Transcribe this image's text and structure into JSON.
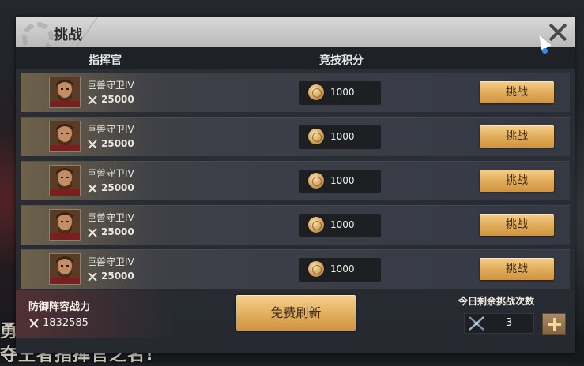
{
  "scene": {
    "text_line1": "勇",
    "text_line2": "夺王者指挥官之名!"
  },
  "dialog": {
    "title": "挑战",
    "columns": {
      "commander": "指挥官",
      "score": "竞技积分"
    },
    "rows": [
      {
        "name": "巨兽守卫IV",
        "power": "25000",
        "score": "1000",
        "button": "挑战"
      },
      {
        "name": "巨兽守卫IV",
        "power": "25000",
        "score": "1000",
        "button": "挑战"
      },
      {
        "name": "巨兽守卫IV",
        "power": "25000",
        "score": "1000",
        "button": "挑战"
      },
      {
        "name": "巨兽守卫IV",
        "power": "25000",
        "score": "1000",
        "button": "挑战"
      },
      {
        "name": "巨兽守卫IV",
        "power": "25000",
        "score": "1000",
        "button": "挑战"
      }
    ],
    "defense": {
      "label": "防御阵容战力",
      "power": "1832585"
    },
    "refresh_button": "免费刷新",
    "remaining": {
      "label": "今日剩余挑战次数",
      "count": "3"
    }
  },
  "icons": {
    "close": "close-icon",
    "swords": "crossed-swords-icon",
    "coin": "coin-icon",
    "blade": "blade-icon",
    "plus": "plus-icon"
  },
  "colors": {
    "gold_button": "#e0aa58",
    "titlebar": "#c8c8c8",
    "dialog_bg": "#2b2f36"
  }
}
